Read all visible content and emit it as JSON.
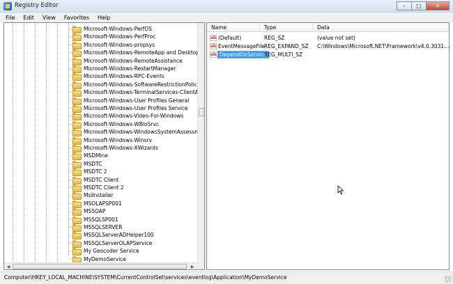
{
  "window": {
    "title": "Registry Editor",
    "minimize_glyph": "–",
    "maximize_glyph": "□",
    "close_glyph": "✕"
  },
  "menu": {
    "items": [
      "File",
      "Edit",
      "View",
      "Favorites",
      "Help"
    ]
  },
  "tree": {
    "nodes": [
      "Microsoft-Windows-PerfOS",
      "Microsoft-Windows-PerfProc",
      "Microsoft-Windows-propsys",
      "Microsoft-Windows-RemoteApp and Desktop Co",
      "Microsoft-Windows-RemoteAssistance",
      "Microsoft-Windows-RestartManager",
      "Microsoft-Windows-RPC-Events",
      "Microsoft-Windows-SoftwareRestrictionPolicies",
      "Microsoft-Windows-TerminalServices-ClientActi",
      "Microsoft-Windows-User Profiles General",
      "Microsoft-Windows-User Profiles Service",
      "Microsoft-Windows-Video-For-Windows",
      "Microsoft-Windows-WBioSrvc",
      "Microsoft-Windows-WindowsSystemAssessment",
      "Microsoft-Windows-Winsrv",
      "Microsoft-Windows-XWizards",
      "MSDMine",
      "MSDTC",
      "MSDTC 2",
      "MSDTC Client",
      "MSDTC Client 2",
      "MsiInstaller",
      "MSOLAPSP001",
      "MSSOAP",
      "MSSQLSP001",
      "MSSQLSERVER",
      "MSSQLServerADHelper100",
      "MSSQLServerOLAPService",
      "My Geocoder Service",
      "MyDemoService"
    ],
    "selected": "MyDemoService"
  },
  "list": {
    "headers": {
      "name": "Name",
      "type": "Type",
      "data": "Data"
    },
    "rows": [
      {
        "name": "(Default)",
        "type": "REG_SZ",
        "data": "(value not set)",
        "icon": "string-value-icon"
      },
      {
        "name": "EventMessageFile",
        "type": "REG_EXPAND_SZ",
        "data": "C:\\Windows\\Microsoft.NET\\Framework\\v4.0.3031...",
        "icon": "string-value-icon"
      },
      {
        "name": "DependOnService",
        "type": "REG_MULTI_SZ",
        "data": "",
        "icon": "string-value-icon"
      }
    ],
    "selected_row": "DependOnService"
  },
  "status": {
    "path": "Computer\\HKEY_LOCAL_MACHINE\\SYSTEM\\CurrentControlSet\\services\\eventlog\\Application\\MyDemoService"
  },
  "colors": {
    "selection": "#3399ff",
    "folder": "#e2b84a",
    "icon_text": "#c0392b"
  }
}
